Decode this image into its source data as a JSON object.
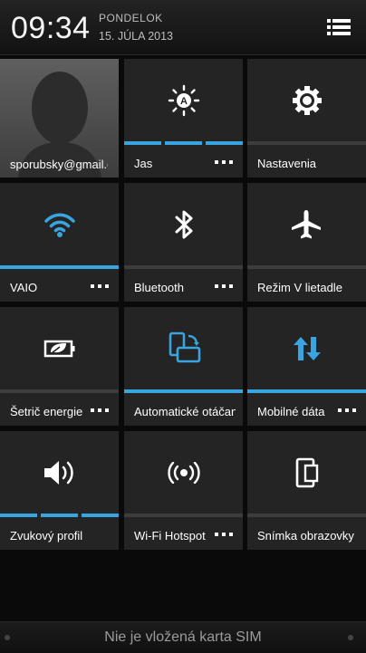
{
  "status": {
    "time": "09:34",
    "day": "PONDELOK",
    "date": "15. JÚLA 2013"
  },
  "tiles": [
    {
      "label": "sporubsky@gmail.com",
      "icon": "avatar-icon"
    },
    {
      "label": "Jas",
      "icon": "brightness-auto-icon"
    },
    {
      "label": "Nastavenia",
      "icon": "gear-icon"
    },
    {
      "label": "VAIO",
      "icon": "wifi-icon"
    },
    {
      "label": "Bluetooth",
      "icon": "bluetooth-icon"
    },
    {
      "label": "Režim V lietadle",
      "icon": "airplane-icon"
    },
    {
      "label": "Šetrič energie",
      "icon": "battery-saver-icon"
    },
    {
      "label": "Automatické otáčanie",
      "icon": "auto-rotate-icon"
    },
    {
      "label": "Mobilné dáta",
      "icon": "mobile-data-icon"
    },
    {
      "label": "Zvukový profil",
      "icon": "volume-icon"
    },
    {
      "label": "Wi-Fi Hotspot",
      "icon": "hotspot-icon"
    },
    {
      "label": "Snímka obrazovky",
      "icon": "screenshot-icon"
    }
  ],
  "footer": {
    "text": "Nie je vložená karta SIM"
  },
  "colors": {
    "accent": "#38a5e0",
    "tile": "#242424"
  }
}
